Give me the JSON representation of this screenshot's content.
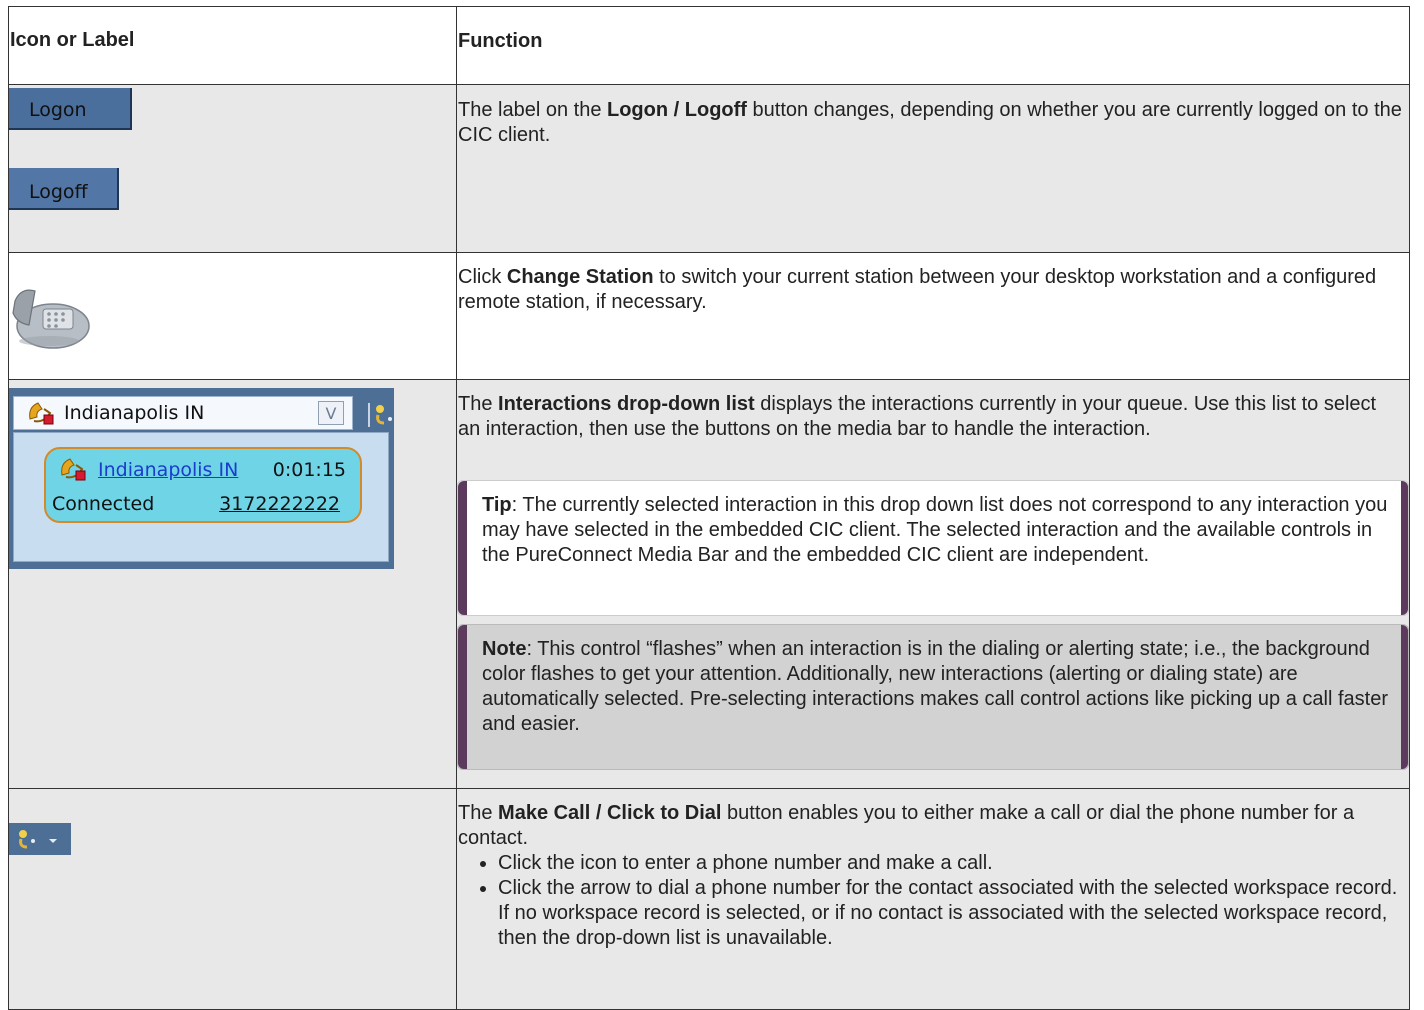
{
  "header": {
    "col1": "Icon or Label",
    "col2": "Function"
  },
  "row1": {
    "logon_label": "Logon",
    "logoff_label": "Logoff",
    "text_pre": "The label on the ",
    "text_bold": "Logon / Logoff",
    "text_post": " button changes, depending on whether you are currently logged on to the CIC client."
  },
  "row2": {
    "icon": "phone-icon",
    "text_pre": "Click ",
    "text_bold": "Change Station",
    "text_post": " to switch your current station between your desktop workstation and a configured remote station, if necessary."
  },
  "row3": {
    "combo_label": "Indianapolis IN",
    "combo_arrow": "V",
    "popup_name": "Indianapolis IN",
    "popup_time": "0:01:15",
    "popup_state": "Connected",
    "popup_number": "3172222222",
    "text_pre": "The ",
    "text_bold": "Interactions drop-down list",
    "text_post": " displays the interactions currently in your queue. Use this list to select an interaction, then use the buttons on the media bar to handle the interaction.",
    "tip_label": "Tip",
    "tip_text": ": The currently selected interaction in this drop down list does not correspond to any interaction you may have selected in the embedded CIC client. The selected interaction and the available controls in the PureConnect Media Bar and the embedded CIC client are independent.",
    "note_label": "Note",
    "note_text": ": This control “flashes” when an interaction is in the dialing or alerting state; i.e., the background color flashes to get your attention. Additionally, new interactions (alerting or dialing state) are automatically selected. Pre-selecting interactions makes call control actions like picking up a call faster and easier."
  },
  "row4": {
    "text_pre": "The ",
    "text_bold": "Make Call / Click to Dial",
    "text_post": " button enables you to either make a call or dial the phone number for a contact.",
    "bullets": [
      "Click the icon to enter a phone number and make a call.",
      "Click the arrow to dial a phone number for the contact associated with the selected workspace record. If no workspace record is selected, or if no contact is associated with the selected workspace record, then the drop-down list is unavailable."
    ]
  },
  "colors": {
    "media_bar": "#4d6f96",
    "note_accent": "#5b3a5e",
    "row_gray": "#e8e8e8"
  }
}
